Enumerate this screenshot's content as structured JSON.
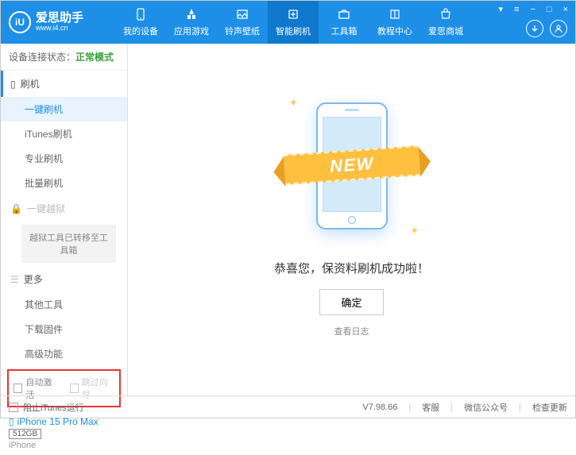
{
  "app": {
    "title": "爱思助手",
    "subtitle": "www.i4.cn",
    "logo_letter": "iU"
  },
  "nav": {
    "items": [
      {
        "label": "我的设备",
        "icon": "phone"
      },
      {
        "label": "应用游戏",
        "icon": "apps"
      },
      {
        "label": "铃声壁纸",
        "icon": "image"
      },
      {
        "label": "智能刷机",
        "icon": "flash"
      },
      {
        "label": "工具箱",
        "icon": "toolbox"
      },
      {
        "label": "教程中心",
        "icon": "book"
      },
      {
        "label": "爱思商城",
        "icon": "shop"
      }
    ],
    "active_index": 3
  },
  "win": {
    "gift": "▾",
    "menu": "≡",
    "min": "−",
    "max": "□",
    "close": "×"
  },
  "status": {
    "label": "设备连接状态：",
    "value": "正常模式"
  },
  "sidebar": {
    "flash_header": "刷机",
    "flash_items": [
      "一键刷机",
      "iTunes刷机",
      "专业刷机",
      "批量刷机"
    ],
    "flash_active": 0,
    "jailbreak": "一键越狱",
    "jailbreak_note": "越狱工具已转移至工具箱",
    "more_header": "更多",
    "more_items": [
      "其他工具",
      "下载固件",
      "高级功能"
    ]
  },
  "options": {
    "auto_activate": "自动激活",
    "skip_guide": "跳过向导"
  },
  "device": {
    "name": "iPhone 15 Pro Max",
    "storage": "512GB",
    "type": "iPhone"
  },
  "main": {
    "ribbon": "NEW",
    "success": "恭喜您，保资料刷机成功啦！",
    "ok": "确定",
    "view_log": "查看日志"
  },
  "footer": {
    "block_itunes": "阻止iTunes运行",
    "version": "V7.98.66",
    "service": "客服",
    "wechat": "微信公众号",
    "check_update": "检查更新"
  }
}
